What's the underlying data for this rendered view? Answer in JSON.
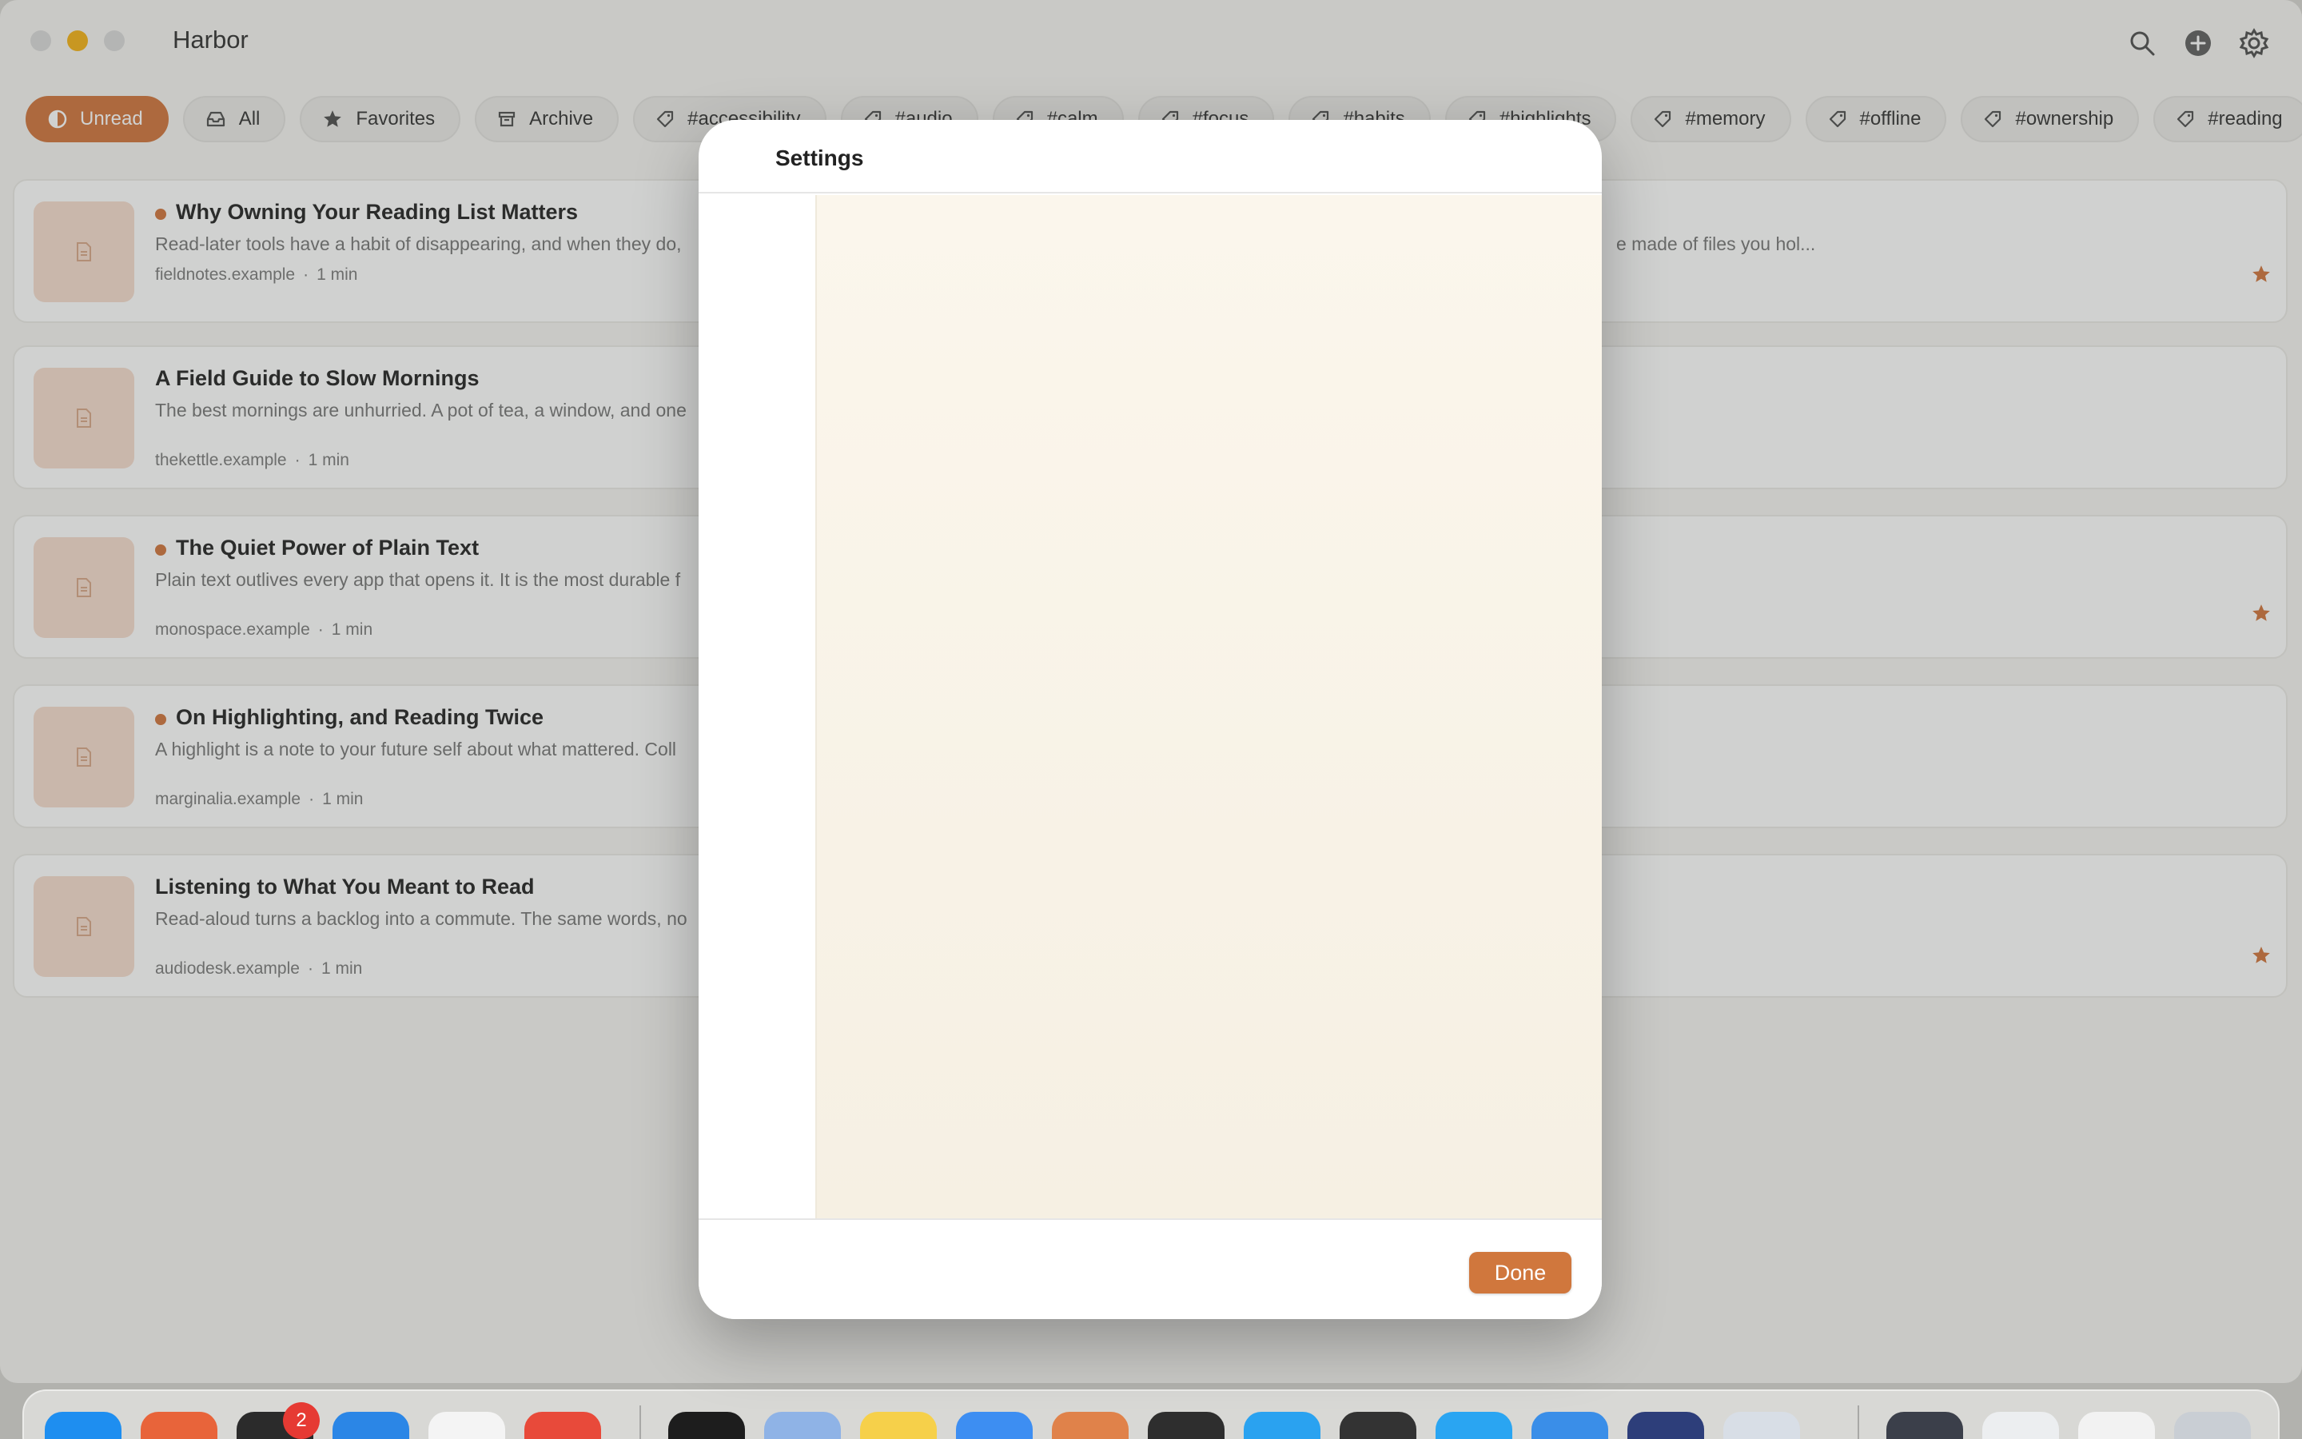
{
  "app": {
    "title": "Harbor"
  },
  "toolbar": {
    "search_icon": "search-icon",
    "add_icon": "plus-circle-icon",
    "settings_icon": "gear-icon"
  },
  "filters": [
    {
      "label": "Unread",
      "icon": "half-circle-icon",
      "active": true
    },
    {
      "label": "All",
      "icon": "tray-icon",
      "active": false
    },
    {
      "label": "Favorites",
      "icon": "star-icon",
      "active": false
    },
    {
      "label": "Archive",
      "icon": "archive-box-icon",
      "active": false
    },
    {
      "label": "#accessibility",
      "icon": "tag-icon",
      "active": false
    },
    {
      "label": "#audio",
      "icon": "tag-icon",
      "active": false
    },
    {
      "label": "#calm",
      "icon": "tag-icon",
      "active": false
    },
    {
      "label": "#focus",
      "icon": "tag-icon",
      "active": false
    },
    {
      "label": "#habits",
      "icon": "tag-icon",
      "active": false
    },
    {
      "label": "#highlights",
      "icon": "tag-icon",
      "active": false
    },
    {
      "label": "#memory",
      "icon": "tag-icon",
      "active": false
    },
    {
      "label": "#offline",
      "icon": "tag-icon",
      "active": false
    },
    {
      "label": "#ownership",
      "icon": "tag-icon",
      "active": false
    },
    {
      "label": "#reading",
      "icon": "tag-icon",
      "active": false
    }
  ],
  "articles": [
    {
      "title": "Why Owning Your Reading List Matters",
      "excerpt": "Read-later tools have a habit of disappearing, and when they do,",
      "excerpt_tail": "e made of files you hol...",
      "source": "fieldnotes.example",
      "read_time": "1 min",
      "unread": true,
      "favorite": true
    },
    {
      "title": "A Field Guide to Slow Mornings",
      "excerpt": "The best mornings are unhurried. A pot of tea, a window, and one",
      "excerpt_tail": "",
      "source": "thekettle.example",
      "read_time": "1 min",
      "unread": false,
      "favorite": false
    },
    {
      "title": "The Quiet Power of Plain Text",
      "excerpt": "Plain text outlives every app that opens it. It is the most durable f",
      "excerpt_tail": "",
      "source": "monospace.example",
      "read_time": "1 min",
      "unread": true,
      "favorite": true
    },
    {
      "title": "On Highlighting, and Reading Twice",
      "excerpt": "A highlight is a note to your future self about what mattered. Coll",
      "excerpt_tail": "",
      "source": "marginalia.example",
      "read_time": "1 min",
      "unread": true,
      "favorite": false
    },
    {
      "title": "Listening to What You Meant to Read",
      "excerpt": "Read-aloud turns a backlog into a commute. The same words, no",
      "excerpt_tail": "",
      "source": "audiodesk.example",
      "read_time": "1 min",
      "unread": false,
      "favorite": true
    }
  ],
  "meta_separator": "·",
  "settings_modal": {
    "title": "Settings",
    "done_label": "Done"
  },
  "dock": {
    "terminal_badge": "2"
  },
  "colors": {
    "accent": "#d27a44",
    "unread_dot": "#d27a44",
    "star": "#d27a44",
    "done_button": "#d0773d"
  }
}
